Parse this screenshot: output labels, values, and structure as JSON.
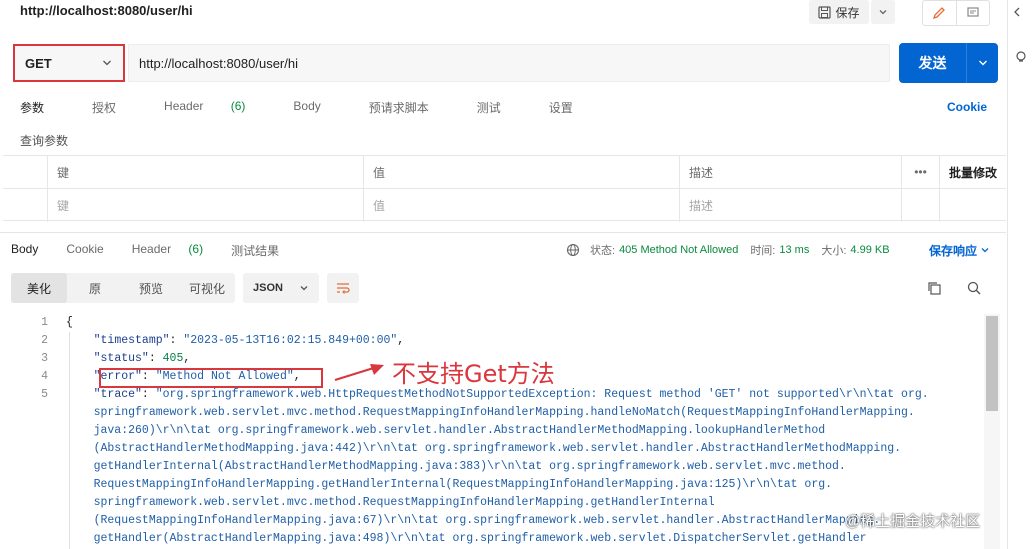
{
  "header": {
    "title": "http://localhost:8080/user/hi",
    "save_label": "保存"
  },
  "request": {
    "method": "GET",
    "url": "http://localhost:8080/user/hi",
    "send_label": "发送",
    "tabs": [
      {
        "label": "参数",
        "active": true
      },
      {
        "label": "授权"
      },
      {
        "label": "Header",
        "count": "(6)"
      },
      {
        "label": "Body"
      },
      {
        "label": "预请求脚本"
      },
      {
        "label": "测试"
      },
      {
        "label": "设置"
      }
    ],
    "cookie_label": "Cookie",
    "query_section_label": "查询参数",
    "table": {
      "headers": {
        "key": "键",
        "value": "值",
        "description": "描述",
        "more": "•••",
        "bulk_edit": "批量修改"
      },
      "placeholders": {
        "key": "键",
        "value": "值",
        "description": "描述"
      }
    }
  },
  "response": {
    "tabs": [
      {
        "label": "Body",
        "active": true
      },
      {
        "label": "Cookie"
      },
      {
        "label": "Header",
        "count": "(6)"
      },
      {
        "label": "测试结果"
      }
    ],
    "status_label": "状态:",
    "status_value": "405 Method Not Allowed",
    "time_label": "时间:",
    "time_value": "13 ms",
    "size_label": "大小:",
    "size_value": "4.99 KB",
    "save_label": "保存响应",
    "view_modes": [
      "美化",
      "原",
      "预览",
      "可视化"
    ],
    "format": "JSON",
    "lines": [
      {
        "n": "1",
        "text": "{"
      },
      {
        "n": "2",
        "key": "\"timestamp\"",
        "value": "\"2023-05-13T16:02:15.849+00:00\"",
        "tail": ","
      },
      {
        "n": "3",
        "key": "\"status\"",
        "value": "405",
        "tail": ","
      },
      {
        "n": "4",
        "key": "\"error\"",
        "value": "\"Method Not Allowed\"",
        "tail": ","
      },
      {
        "n": "5",
        "key": "\"trace\"",
        "value": "\"org.springframework.web.HttpRequestMethodNotSupportedException: Request method 'GET' not supported\\r\\n\\tat org."
      },
      {
        "n": "",
        "text": "    springframework.web.servlet.mvc.method.RequestMappingInfoHandlerMapping.handleNoMatch(RequestMappingInfoHandlerMapping."
      },
      {
        "n": "",
        "text": "    java:260)\\r\\n\\tat org.springframework.web.servlet.handler.AbstractHandlerMethodMapping.lookupHandlerMethod"
      },
      {
        "n": "",
        "text": "    (AbstractHandlerMethodMapping.java:442)\\r\\n\\tat org.springframework.web.servlet.handler.AbstractHandlerMethodMapping."
      },
      {
        "n": "",
        "text": "    getHandlerInternal(AbstractHandlerMethodMapping.java:383)\\r\\n\\tat org.springframework.web.servlet.mvc.method."
      },
      {
        "n": "",
        "text": "    RequestMappingInfoHandlerMapping.getHandlerInternal(RequestMappingInfoHandlerMapping.java:125)\\r\\n\\tat org."
      },
      {
        "n": "",
        "text": "    springframework.web.servlet.mvc.method.RequestMappingInfoHandlerMapping.getHandlerInternal"
      },
      {
        "n": "",
        "text": "    (RequestMappingInfoHandlerMapping.java:67)\\r\\n\\tat org.springframework.web.servlet.handler.AbstractHandlerMapping."
      },
      {
        "n": "",
        "text": "    getHandler(AbstractHandlerMapping.java:498)\\r\\n\\tat org.springframework.web.servlet.DispatcherServlet.getHandler"
      }
    ]
  },
  "annotation": {
    "text": "不支持Get方法",
    "color": "#d9363e"
  },
  "watermark": "@稀土掘金技术社区",
  "colors": {
    "accent": "#0265d2",
    "success": "#0a8a3e",
    "annotation": "#d9363e"
  }
}
